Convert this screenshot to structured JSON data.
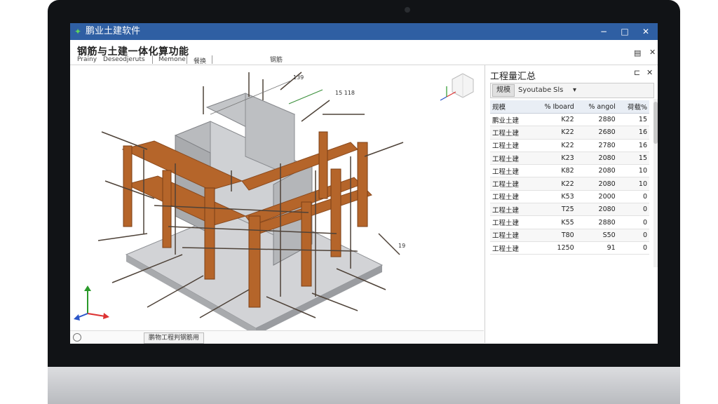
{
  "window": {
    "title": "鹏业土建软件",
    "controls": [
      "−",
      "□",
      "✕"
    ]
  },
  "toolbar": {
    "feature_title": "钢筋与土建一体化算功能",
    "menu": [
      "Prainy",
      "Deseodjeruts",
      "Memone",
      "餐换"
    ],
    "extra_label": "钢筋"
  },
  "model": {
    "annotations": [
      "139",
      "15 118",
      "19"
    ],
    "colors": {
      "column": "#b5652a",
      "slab": "#bfc1c4",
      "wall": "#c9cbce",
      "rebar": "#5a4a3a"
    }
  },
  "status": {
    "tab_label": "鹏物工程判钢筋用"
  },
  "panel": {
    "title": "工程量汇总",
    "tabs": [
      "规模",
      "Syoutabe",
      "Sls"
    ],
    "columns": [
      "规模",
      "% Iboard",
      "% angol",
      "荷载%"
    ],
    "rows": [
      [
        "鹏业土建",
        "K22",
        "2880",
        "15"
      ],
      [
        "工程土建",
        "K22",
        "2680",
        "16"
      ],
      [
        "工程土建",
        "K22",
        "2780",
        "16"
      ],
      [
        "工程土建",
        "K23",
        "2080",
        "15"
      ],
      [
        "工程土建",
        "K82",
        "2080",
        "10"
      ],
      [
        "工程土建",
        "K22",
        "2080",
        "10"
      ],
      [
        "工程土建",
        "K53",
        "2000",
        "0"
      ],
      [
        "工程土建",
        "T25",
        "2080",
        "0"
      ],
      [
        "工程土建",
        "K55",
        "2880",
        "0"
      ],
      [
        "工程土建",
        "T80",
        "S50",
        "0"
      ],
      [
        "工程土建",
        "1250",
        "91",
        "0"
      ]
    ]
  }
}
